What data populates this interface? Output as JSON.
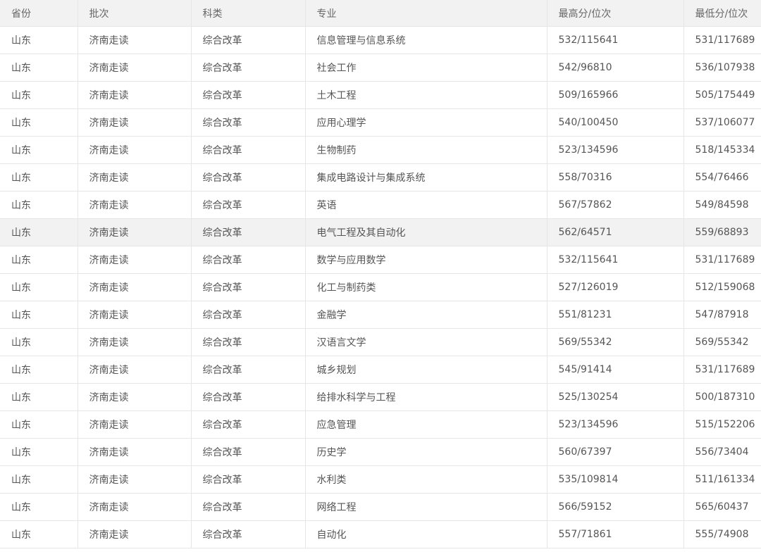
{
  "table": {
    "headers": [
      "省份",
      "批次",
      "科类",
      "专业",
      "最高分/位次",
      "最低分/位次"
    ],
    "highlighted_row": 7,
    "rows": [
      [
        "山东",
        "济南走读",
        "综合改革",
        "信息管理与信息系统",
        "532/115641",
        "531/117689"
      ],
      [
        "山东",
        "济南走读",
        "综合改革",
        "社会工作",
        "542/96810",
        "536/107938"
      ],
      [
        "山东",
        "济南走读",
        "综合改革",
        "土木工程",
        "509/165966",
        "505/175449"
      ],
      [
        "山东",
        "济南走读",
        "综合改革",
        "应用心理学",
        "540/100450",
        "537/106077"
      ],
      [
        "山东",
        "济南走读",
        "综合改革",
        "生物制药",
        "523/134596",
        "518/145334"
      ],
      [
        "山东",
        "济南走读",
        "综合改革",
        "集成电路设计与集成系统",
        "558/70316",
        "554/76466"
      ],
      [
        "山东",
        "济南走读",
        "综合改革",
        "英语",
        "567/57862",
        "549/84598"
      ],
      [
        "山东",
        "济南走读",
        "综合改革",
        "电气工程及其自动化",
        "562/64571",
        "559/68893"
      ],
      [
        "山东",
        "济南走读",
        "综合改革",
        "数学与应用数学",
        "532/115641",
        "531/117689"
      ],
      [
        "山东",
        "济南走读",
        "综合改革",
        "化工与制药类",
        "527/126019",
        "512/159068"
      ],
      [
        "山东",
        "济南走读",
        "综合改革",
        "金融学",
        "551/81231",
        "547/87918"
      ],
      [
        "山东",
        "济南走读",
        "综合改革",
        "汉语言文学",
        "569/55342",
        "569/55342"
      ],
      [
        "山东",
        "济南走读",
        "综合改革",
        "城乡规划",
        "545/91414",
        "531/117689"
      ],
      [
        "山东",
        "济南走读",
        "综合改革",
        "给排水科学与工程",
        "525/130254",
        "500/187310"
      ],
      [
        "山东",
        "济南走读",
        "综合改革",
        "应急管理",
        "523/134596",
        "515/152206"
      ],
      [
        "山东",
        "济南走读",
        "综合改革",
        "历史学",
        "560/67397",
        "556/73404"
      ],
      [
        "山东",
        "济南走读",
        "综合改革",
        "水利类",
        "535/109814",
        "511/161334"
      ],
      [
        "山东",
        "济南走读",
        "综合改革",
        "网络工程",
        "566/59152",
        "565/60437"
      ],
      [
        "山东",
        "济南走读",
        "综合改革",
        "自动化",
        "557/71861",
        "555/74908"
      ]
    ]
  }
}
